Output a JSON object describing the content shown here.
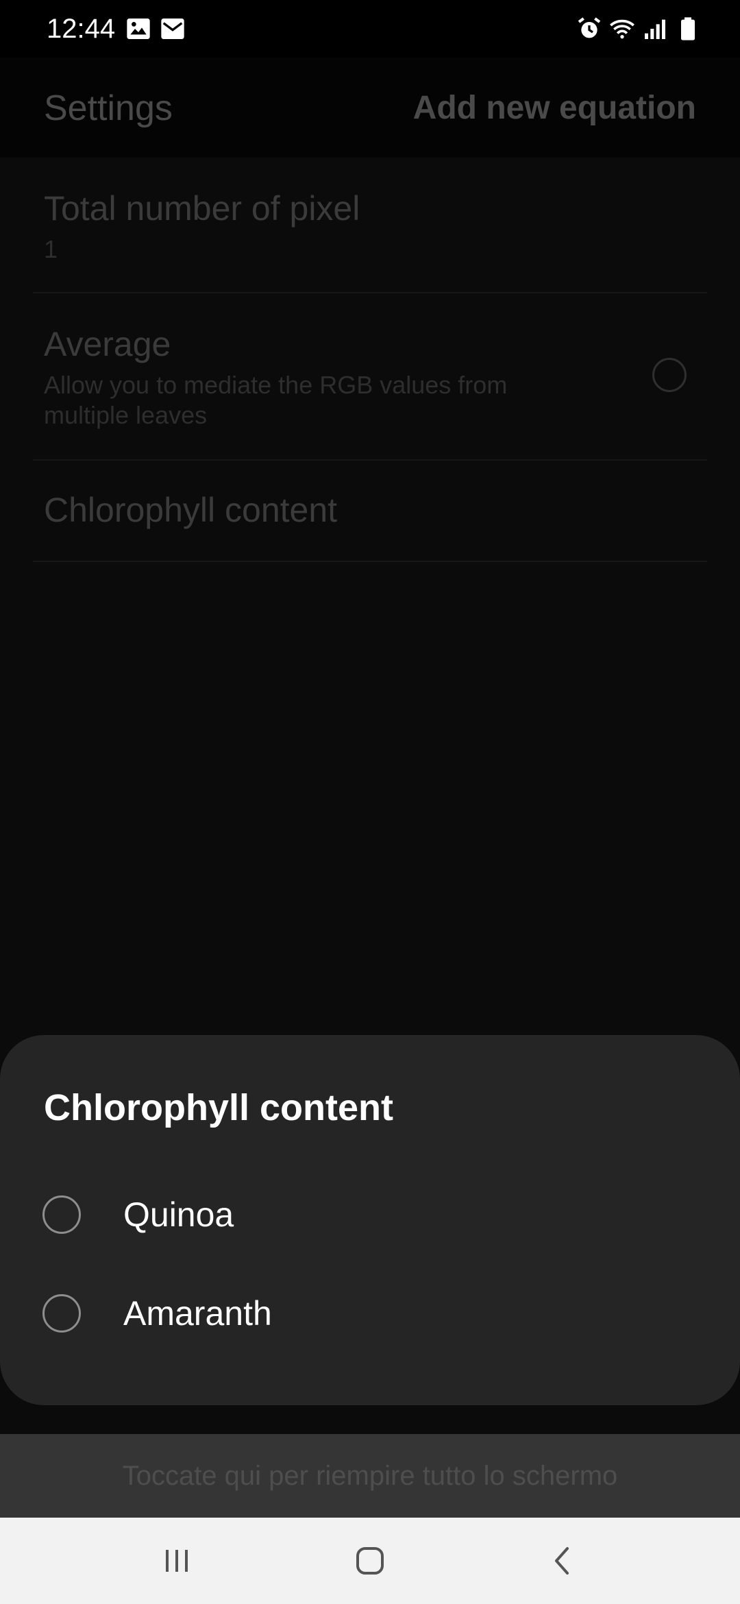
{
  "status_bar": {
    "time": "12:44",
    "icons": [
      "image-icon",
      "mail-icon",
      "alarm-icon",
      "wifi-icon",
      "signal-icon",
      "battery-icon"
    ]
  },
  "app_bar": {
    "title": "Settings",
    "action_label": "Add new equation"
  },
  "settings": {
    "items": [
      {
        "title": "Total number of pixel",
        "summary": "1"
      },
      {
        "title": "Average",
        "summary": "Allow you to mediate the RGB values from multiple leaves",
        "checked": false
      },
      {
        "title": "Chlorophyll content"
      }
    ]
  },
  "dialog": {
    "title": "Chlorophyll content",
    "options": [
      {
        "label": "Quinoa",
        "selected": false
      },
      {
        "label": "Amaranth",
        "selected": false
      }
    ]
  },
  "fullscreen_hint": "Toccate qui per riempire tutto lo schermo",
  "navigation": {
    "buttons": [
      "recent-apps-icon",
      "home-icon",
      "back-icon"
    ]
  },
  "colors": {
    "scrim_background": "#0b0b0b",
    "sheet_background": "#252525",
    "nav_background": "#f2f2f2"
  }
}
